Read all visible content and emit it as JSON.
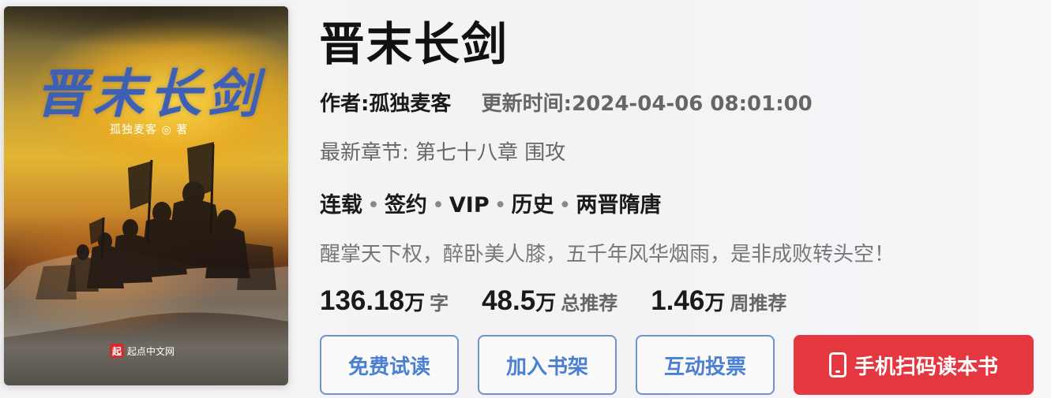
{
  "cover": {
    "title": "晋末长剑",
    "author_line": "孤独麦客 ◎ 著",
    "publisher_badge": "起",
    "publisher": "起点中文网"
  },
  "book": {
    "title": "晋末长剑",
    "author": "作者:孤独麦客",
    "updated": "更新时间:2024-04-06 08:01:00",
    "latest_chapter": "最新章节: 第七十八章 围攻",
    "tags": [
      "连载",
      "签约",
      "VIP",
      "历史",
      "两晋隋唐"
    ],
    "tag_separator": "•",
    "intro": "醒掌天下权，醉卧美人膝，五千年风华烟雨，是非成败转头空！"
  },
  "stats": [
    {
      "num": "136.18",
      "unit": "万",
      "label": "字"
    },
    {
      "num": "48.5",
      "unit": "万",
      "label": "总推荐"
    },
    {
      "num": "1.46",
      "unit": "万",
      "label": "周推荐"
    }
  ],
  "buttons": {
    "free_read": "免费试读",
    "add_shelf": "加入书架",
    "vote": "互动投票",
    "mobile": "手机扫码读本书",
    "mobile_icon": "phone-icon"
  },
  "colors": {
    "accent_blue": "#4a7fd1",
    "primary_red": "#e4373f"
  }
}
